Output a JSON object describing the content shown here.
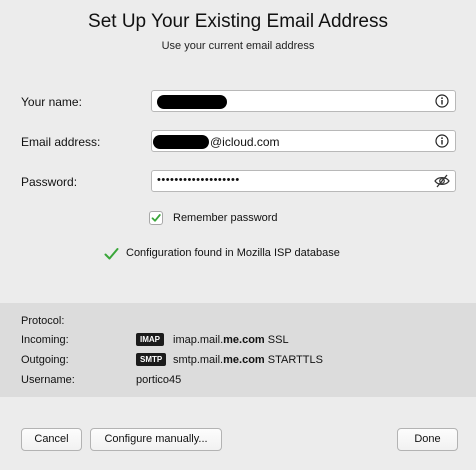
{
  "dialog": {
    "title": "Set Up Your Existing Email Address",
    "subtitle": "Use your current email address"
  },
  "form": {
    "name_label": "Your name:",
    "email_label": "Email address:",
    "email_suffix": "@icloud.com",
    "password_label": "Password:",
    "password_mask": "•••••••••••••••••••",
    "remember_label": "Remember password",
    "remember_checked": true
  },
  "status": {
    "message": "Configuration found in Mozilla ISP database",
    "color": "#3aa63a"
  },
  "config": {
    "protocol_label": "Protocol:",
    "incoming_label": "Incoming:",
    "outgoing_label": "Outgoing:",
    "username_label": "Username:",
    "incoming_badge": "IMAP",
    "incoming_host_prefix": "imap.mail.",
    "incoming_host_domain": "me.com",
    "incoming_security": "SSL",
    "outgoing_badge": "SMTP",
    "outgoing_host_prefix": "smtp.mail.",
    "outgoing_host_domain": "me.com",
    "outgoing_security": "STARTTLS",
    "username": "portico45"
  },
  "buttons": {
    "cancel": "Cancel",
    "configure": "Configure manually...",
    "done": "Done"
  },
  "icons": {
    "info": "info-circle-icon",
    "reveal": "eye-slash-icon",
    "check": "checkmark-icon"
  }
}
